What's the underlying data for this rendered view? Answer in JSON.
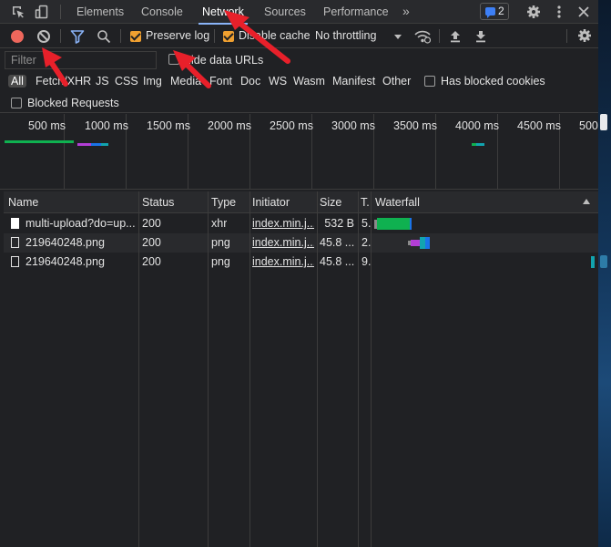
{
  "tabs": {
    "elements": "Elements",
    "console": "Console",
    "network": "Network",
    "sources": "Sources",
    "performance": "Performance",
    "more": "»"
  },
  "issues_count": "2",
  "toolbar": {
    "preserve_log": "Preserve log",
    "disable_cache": "Disable cache",
    "throttling": "No throttling"
  },
  "filter": {
    "placeholder": "Filter",
    "hide_data_urls": "Hide data URLs"
  },
  "types": [
    "All",
    "Fetch/XHR",
    "JS",
    "CSS",
    "Img",
    "Media",
    "Font",
    "Doc",
    "WS",
    "Wasm",
    "Manifest",
    "Other"
  ],
  "has_blocked_cookies": "Has blocked cookies",
  "blocked_requests": "Blocked Requests",
  "overview_ticks": [
    "500 ms",
    "1000 ms",
    "1500 ms",
    "2000 ms",
    "2500 ms",
    "3000 ms",
    "3500 ms",
    "4000 ms",
    "4500 ms",
    "500"
  ],
  "columns": {
    "name": "Name",
    "status": "Status",
    "type": "Type",
    "initiator": "Initiator",
    "size": "Size",
    "time": "T.",
    "waterfall": "Waterfall"
  },
  "requests": [
    {
      "name": "multi-upload?do=up...",
      "status": "200",
      "type": "xhr",
      "initiator": "index.min.j...",
      "size": "532 B",
      "time": "5."
    },
    {
      "name": "219640248.png",
      "status": "200",
      "type": "png",
      "initiator": "index.min.j...",
      "size": "45.8 ...",
      "time": "2."
    },
    {
      "name": "219640248.png",
      "status": "200",
      "type": "png",
      "initiator": "index.min.j...",
      "size": "45.8 ...",
      "time": "9."
    }
  ],
  "colors": {
    "accent": "#8ab4f8",
    "record": "#ee675c",
    "checkbox": "#f0a030",
    "annotation": "#e8202a",
    "waterfall_green": "#0fb150",
    "waterfall_purple": "#b33ed6",
    "waterfall_blue": "#1a73e8",
    "waterfall_teal": "#12a4af"
  },
  "icons": [
    "inspect-icon",
    "device-toolbar-icon",
    "record-icon",
    "clear-icon",
    "filter-icon",
    "search-icon",
    "wifi-conditions-icon",
    "import-har-icon",
    "export-har-icon",
    "settings-icon",
    "close-icon",
    "kebab-menu-icon",
    "issues-icon"
  ]
}
